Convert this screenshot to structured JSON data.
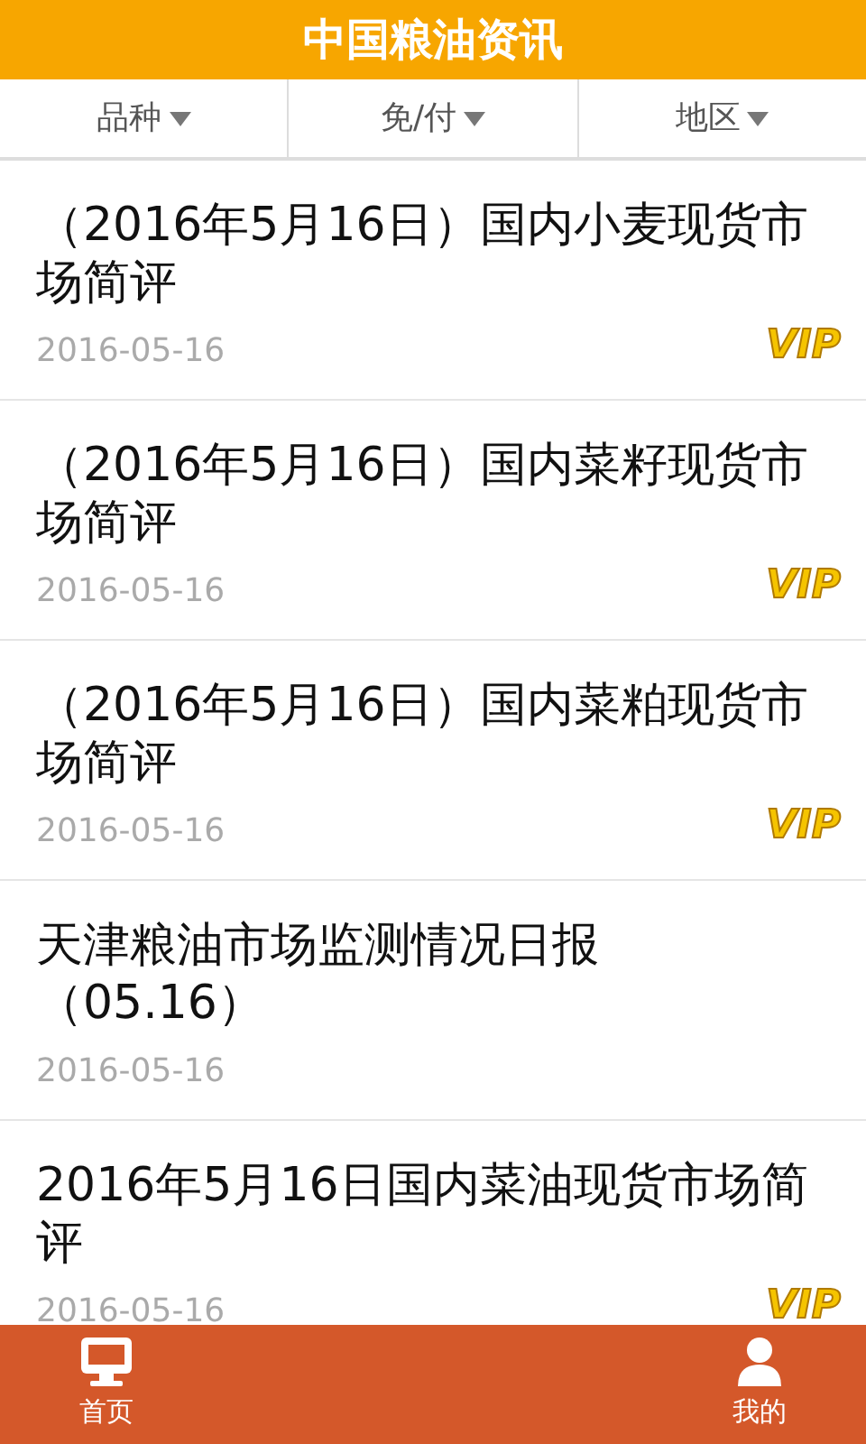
{
  "header": {
    "title": "中国粮油资讯"
  },
  "filters": [
    {
      "label": "品种"
    },
    {
      "label": "免/付"
    },
    {
      "label": "地区"
    }
  ],
  "articles": [
    {
      "title": "（2016年5月16日）国内小麦现货市场简评",
      "date": "2016-05-16",
      "badge": "VIP"
    },
    {
      "title": "（2016年5月16日）国内菜籽现货市场简评",
      "date": "2016-05-16",
      "badge": "VIP"
    },
    {
      "title": "（2016年5月16日）国内菜粕现货市场简评",
      "date": "2016-05-16",
      "badge": "VIP"
    },
    {
      "title": "天津粮油市场监测情况日报（05.16）",
      "date": "2016-05-16"
    },
    {
      "title": "2016年5月16日国内菜油现货市场简评",
      "date": "2016-05-16",
      "badge": "VIP"
    }
  ],
  "tab_bar": [
    {
      "label": "首页",
      "kind": "home"
    },
    {
      "label": "我的",
      "kind": "profile"
    }
  ]
}
